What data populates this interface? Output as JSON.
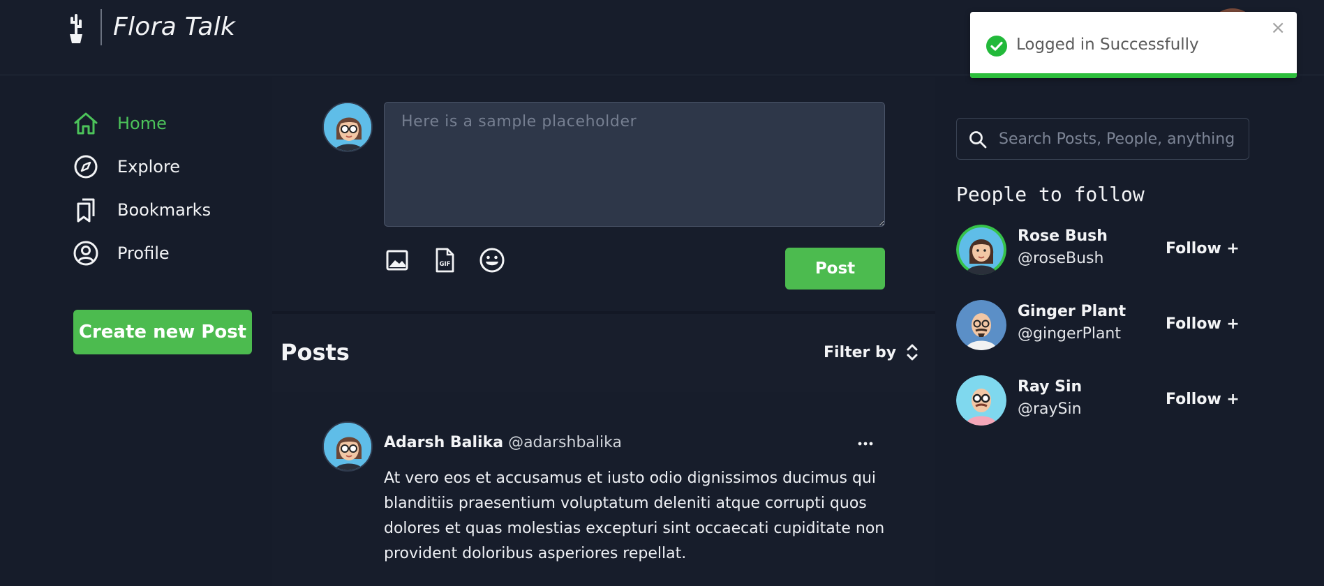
{
  "app": {
    "name": "Flora Talk",
    "accent": "#4cbb4f",
    "background": "#161c2a"
  },
  "toast": {
    "message": "Logged in Successfully",
    "close_glyph": "×",
    "status": "success",
    "color": "#2dbe3c"
  },
  "nav": {
    "items": [
      {
        "label": "Home",
        "icon": "home-icon",
        "active": true
      },
      {
        "label": "Explore",
        "icon": "compass-icon",
        "active": false
      },
      {
        "label": "Bookmarks",
        "icon": "bookmarks-icon",
        "active": false
      },
      {
        "label": "Profile",
        "icon": "user-circle-icon",
        "active": false
      }
    ],
    "create_label": "Create new Post"
  },
  "composer": {
    "placeholder": "Here is a sample placeholder",
    "tools": [
      "image-icon",
      "gif-icon",
      "emoji-icon"
    ],
    "post_label": "Post"
  },
  "feed": {
    "title": "Posts",
    "filter_label": "Filter by",
    "posts": [
      {
        "name": "Adarsh Balika",
        "handle": "@adarshbalika",
        "body": "At vero eos et accusamus et iusto odio dignissimos ducimus qui blanditiis praesentium voluptatum deleniti atque corrupti quos dolores et quas molestias excepturi sint occaecati cupiditate non provident doloribus asperiores repellat."
      }
    ]
  },
  "search": {
    "placeholder": "Search Posts, People, anything"
  },
  "people": {
    "title": "People to follow",
    "follow_label": "Follow +",
    "list": [
      {
        "name": "Rose Bush",
        "handle": "@roseBush"
      },
      {
        "name": "Ginger Plant",
        "handle": "@gingerPlant"
      },
      {
        "name": "Ray Sin",
        "handle": "@raySin"
      }
    ]
  }
}
